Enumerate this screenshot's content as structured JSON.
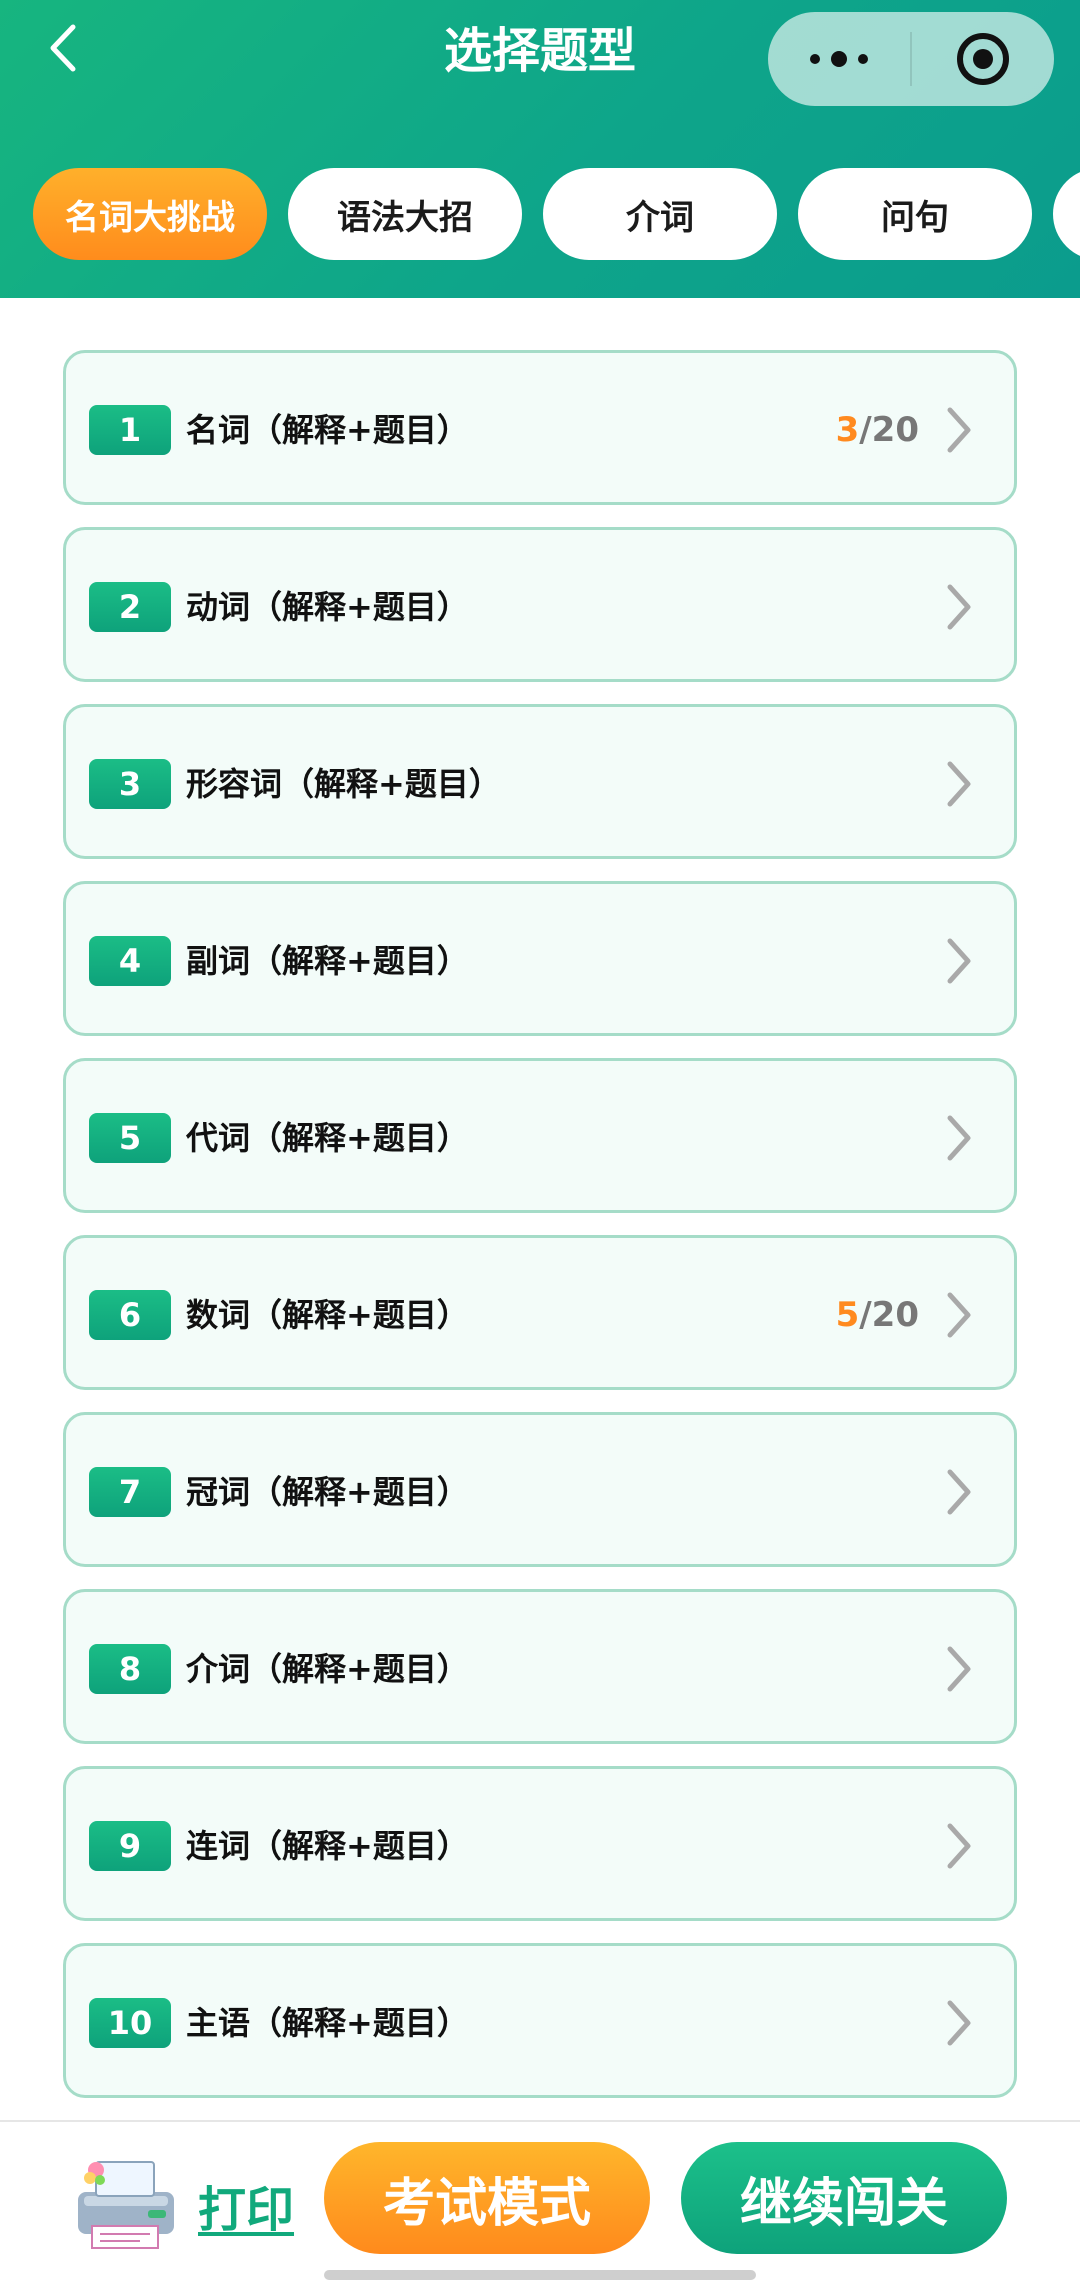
{
  "header": {
    "title": "选择题型",
    "back_icon": "chevron-left-icon",
    "menu_icon": "more-dots-icon",
    "close_icon": "target-icon"
  },
  "tabs": [
    {
      "label": "名词大挑战",
      "active": true
    },
    {
      "label": "语法大招",
      "active": false
    },
    {
      "label": "介词",
      "active": false
    },
    {
      "label": "问句",
      "active": false
    }
  ],
  "items": [
    {
      "number": "1",
      "label": "名词（解释+题目）",
      "progress_done": "3",
      "progress_total": "/20"
    },
    {
      "number": "2",
      "label": "动词（解释+题目）"
    },
    {
      "number": "3",
      "label": "形容词（解释+题目）"
    },
    {
      "number": "4",
      "label": "副词（解释+题目）"
    },
    {
      "number": "5",
      "label": "代词（解释+题目）"
    },
    {
      "number": "6",
      "label": "数词（解释+题目）",
      "progress_done": "5",
      "progress_total": "/20"
    },
    {
      "number": "7",
      "label": "冠词（解释+题目）"
    },
    {
      "number": "8",
      "label": "介词（解释+题目）"
    },
    {
      "number": "9",
      "label": "连词（解释+题目）"
    },
    {
      "number": "10",
      "label": "主语（解释+题目）"
    }
  ],
  "bottom": {
    "print_label": "打印",
    "exam_label": "考试模式",
    "continue_label": "继续闯关"
  },
  "colors": {
    "header_green": "#17b57f",
    "accent_orange": "#ff8c1c",
    "card_border": "#a5dcc8",
    "card_bg": "#f3fcf9"
  }
}
